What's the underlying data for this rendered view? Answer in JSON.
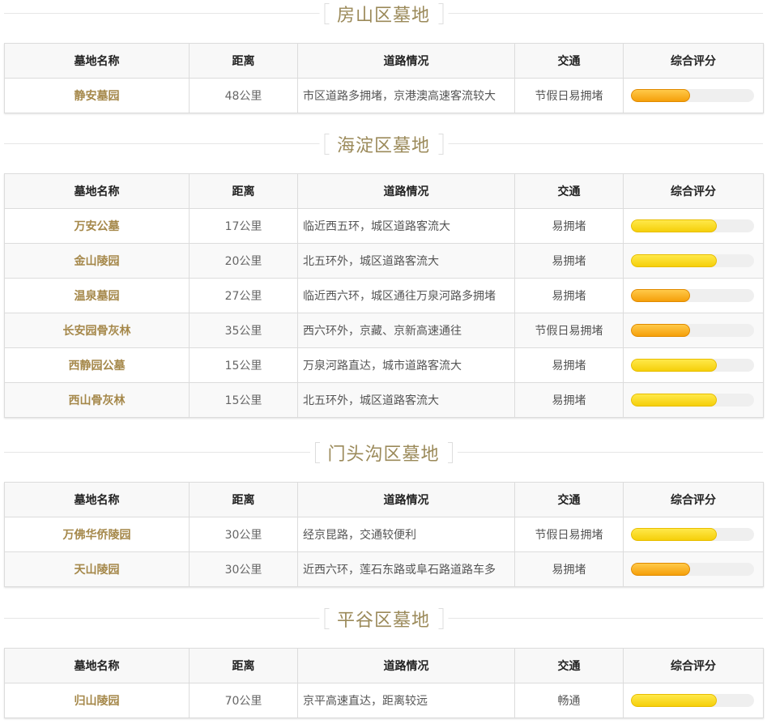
{
  "headers": {
    "name": "墓地名称",
    "distance": "距离",
    "road": "道路情况",
    "traffic": "交通",
    "rating": "综合评分"
  },
  "sections": [
    {
      "title": "房山区墓地",
      "rows": [
        {
          "name": "静安墓园",
          "distance": "48公里",
          "road": "市区道路多拥堵，京港澳高速客流较大",
          "traffic": "节假日易拥堵",
          "rating": 0.48,
          "color": "#f5a70f"
        }
      ]
    },
    {
      "title": "海淀区墓地",
      "rows": [
        {
          "name": "万安公墓",
          "distance": "17公里",
          "road": "临近西五环，城区道路客流大",
          "traffic": "易拥堵",
          "rating": 0.7,
          "color": "#f7d514"
        },
        {
          "name": "金山陵园",
          "distance": "20公里",
          "road": "北五环外，城区道路客流大",
          "traffic": "易拥堵",
          "rating": 0.7,
          "color": "#f7d514"
        },
        {
          "name": "温泉墓园",
          "distance": "27公里",
          "road": "临近西六环，城区通往万泉河路多拥堵",
          "traffic": "易拥堵",
          "rating": 0.48,
          "color": "#f5a70f"
        },
        {
          "name": "长安园骨灰林",
          "distance": "35公里",
          "road": "西六环外，京藏、京新高速通往",
          "traffic": "节假日易拥堵",
          "rating": 0.48,
          "color": "#f5a70f"
        },
        {
          "name": "西静园公墓",
          "distance": "15公里",
          "road": "万泉河路直达，城市道路客流大",
          "traffic": "易拥堵",
          "rating": 0.7,
          "color": "#f7d514"
        },
        {
          "name": "西山骨灰林",
          "distance": "15公里",
          "road": "北五环外，城区道路客流大",
          "traffic": "易拥堵",
          "rating": 0.7,
          "color": "#f7d514"
        }
      ]
    },
    {
      "title": "门头沟区墓地",
      "rows": [
        {
          "name": "万佛华侨陵园",
          "distance": "30公里",
          "road": "经京昆路，交通较便利",
          "traffic": "节假日易拥堵",
          "rating": 0.7,
          "color": "#f7d514"
        },
        {
          "name": "天山陵园",
          "distance": "30公里",
          "road": "近西六环，莲石东路或阜石路道路车多",
          "traffic": "易拥堵",
          "rating": 0.48,
          "color": "#f5a70f"
        }
      ]
    },
    {
      "title": "平谷区墓地",
      "rows": [
        {
          "name": "归山陵园",
          "distance": "70公里",
          "road": "京平高速直达，距离较远",
          "traffic": "畅通",
          "rating": 0.7,
          "color": "#f7d514"
        }
      ]
    }
  ]
}
